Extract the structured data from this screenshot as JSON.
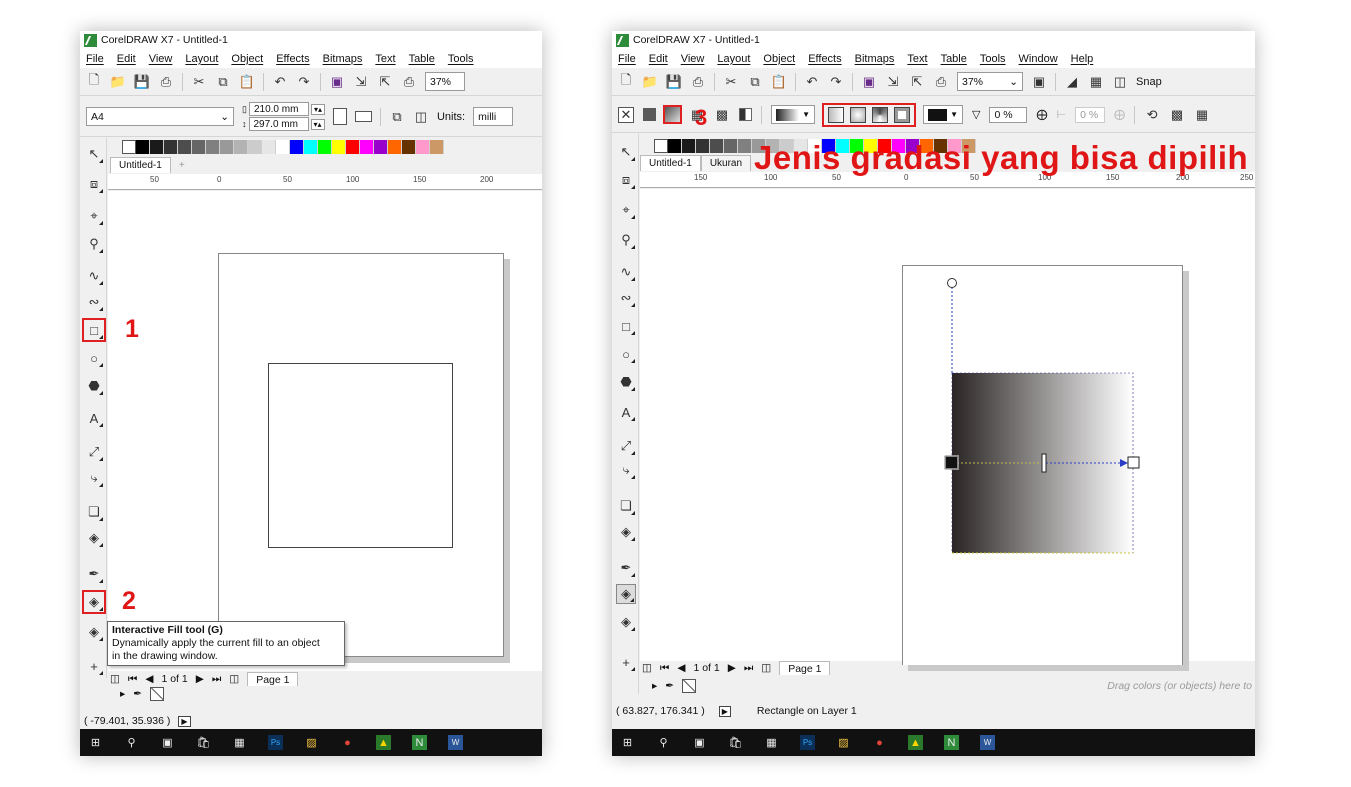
{
  "left": {
    "title": "CorelDRAW X7 - Untitled-1",
    "menu": [
      "File",
      "Edit",
      "View",
      "Layout",
      "Object",
      "Effects",
      "Bitmaps",
      "Text",
      "Table",
      "Tools"
    ],
    "zoom": "37%",
    "page_size": "A4",
    "width": "210.0 mm",
    "height": "297.0 mm",
    "units_label": "Units:",
    "units_value": "milli",
    "doc_tab": "Untitled-1",
    "ruler_ticks": [
      "50",
      "0",
      "50",
      "100",
      "150",
      "200"
    ],
    "callout_1": "1",
    "callout_2": "2",
    "tooltip_title": "Interactive Fill tool (G)",
    "tooltip_line1": "Dynamically apply the current fill to an object",
    "tooltip_line2": "in the drawing window.",
    "page_nav": "1 of 1",
    "page_tab": "Page 1",
    "coords": "( -79.401, 35.936 )"
  },
  "right": {
    "title": "CorelDRAW X7 - Untitled-1",
    "menu": [
      "File",
      "Edit",
      "View",
      "Layout",
      "Object",
      "Effects",
      "Bitmaps",
      "Text",
      "Table",
      "Tools",
      "Window",
      "Help"
    ],
    "zoom": "37%",
    "snap_label": "Snap",
    "transparency_a": "0 %",
    "transparency_b": "0 %",
    "callout_3": "3",
    "doc_tab": "Untitled-1",
    "doc_tab2": "Ukuran",
    "annotation": "Jenis gradasi yang bisa dipilih",
    "ruler_ticks": [
      "150",
      "100",
      "50",
      "0",
      "50",
      "100",
      "150",
      "200",
      "250"
    ],
    "page_nav": "1 of 1",
    "page_tab": "Page 1",
    "drag_hint": "Drag colors (or objects) here to",
    "coords": "( 63.827, 176.341 )",
    "status_object": "Rectangle on Layer 1"
  },
  "palette_colors": [
    "#000000",
    "#1a1a1a",
    "#333333",
    "#4d4d4d",
    "#666666",
    "#808080",
    "#999999",
    "#b3b3b3",
    "#cccccc",
    "#e6e6e6",
    "#ffffff",
    "#0000ff",
    "#00ffff",
    "#00ff00",
    "#ffff00",
    "#ff0000",
    "#ff00ff",
    "#9900cc",
    "#ff6600",
    "#663300",
    "#ff99cc",
    "#cc9966"
  ],
  "annotation_color": "#e01515",
  "gradient": {
    "from": "#2a2424",
    "to": "#ffffff"
  }
}
